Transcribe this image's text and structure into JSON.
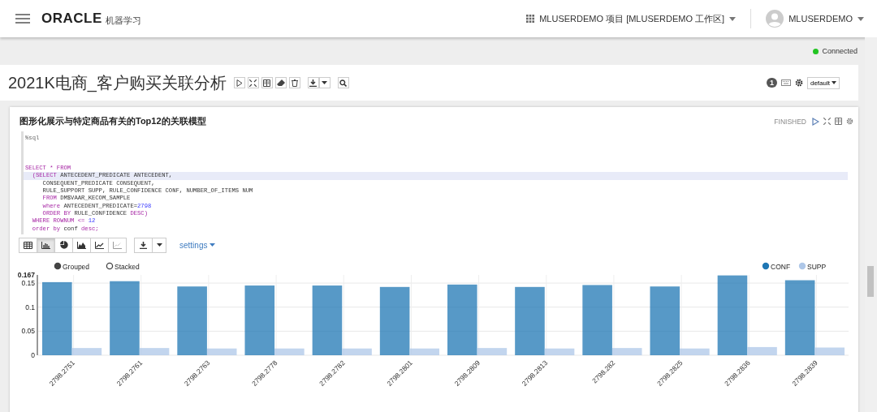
{
  "header": {
    "logo": "ORACLE",
    "product": "机器学习",
    "project": "MLUSERDEMO 项目 [MLUSERDEMO 工作区]",
    "user": "MLUSERDEMO"
  },
  "status": {
    "label": "Connected",
    "connected": true
  },
  "notebook": {
    "title": "2021K电商_客户购买关联分析",
    "badge": "1",
    "view_mode": "default"
  },
  "paragraph": {
    "title": "图形化展示与特定商品有关的Top12的关联模型",
    "state": "FINISHED",
    "code": [
      {
        "kind": "code",
        "highlighted": false,
        "tokens": [
          {
            "kind": "comment",
            "text": "%sql"
          }
        ]
      },
      {
        "kind": "blank"
      },
      {
        "kind": "blank"
      },
      {
        "kind": "blank"
      },
      {
        "kind": "code",
        "highlighted": false,
        "tokens": [
          {
            "kind": "keyword",
            "text": "SELECT * FROM"
          }
        ]
      },
      {
        "kind": "code",
        "highlighted": true,
        "tokens": [
          {
            "kind": "keyword",
            "text": "  (SELECT"
          },
          {
            "kind": "plain",
            "text": " ANTECEDENT_PREDICATE ANTECEDENT,"
          }
        ]
      },
      {
        "kind": "code",
        "highlighted": false,
        "tokens": [
          {
            "kind": "plain",
            "text": "     CONSEQUENT_PREDICATE CONSEQUENT,"
          }
        ]
      },
      {
        "kind": "code",
        "highlighted": false,
        "tokens": [
          {
            "kind": "plain",
            "text": "     RULE_SUPPORT SUPP, RULE_CONFIDENCE CONF, NUMBER_OF_ITEMS NUM"
          }
        ]
      },
      {
        "kind": "code",
        "highlighted": false,
        "tokens": [
          {
            "kind": "keyword",
            "text": "     FROM"
          },
          {
            "kind": "plain",
            "text": " DM$VAAR_KECOM_SAMPLE"
          }
        ]
      },
      {
        "kind": "code",
        "highlighted": false,
        "tokens": [
          {
            "kind": "keyword",
            "text": "     where"
          },
          {
            "kind": "plain",
            "text": " ANTECEDENT_PREDICATE="
          },
          {
            "kind": "number",
            "text": "2798"
          }
        ]
      },
      {
        "kind": "code",
        "highlighted": false,
        "tokens": [
          {
            "kind": "keyword",
            "text": "     ORDER BY"
          },
          {
            "kind": "plain",
            "text": " RULE_CONFIDENCE "
          },
          {
            "kind": "keyword",
            "text": "DESC)"
          }
        ]
      },
      {
        "kind": "code",
        "highlighted": false,
        "tokens": [
          {
            "kind": "keyword",
            "text": "  WHERE ROWNUM <= "
          },
          {
            "kind": "number",
            "text": "12"
          }
        ]
      },
      {
        "kind": "code",
        "highlighted": false,
        "tokens": [
          {
            "kind": "keyword",
            "text": "  order by"
          },
          {
            "kind": "plain",
            "text": " conf "
          },
          {
            "kind": "keyword",
            "text": "desc;"
          }
        ]
      }
    ],
    "views": [
      {
        "kind": "table",
        "selected": false
      },
      {
        "kind": "bar",
        "selected": true
      },
      {
        "kind": "pie",
        "selected": false
      },
      {
        "kind": "area",
        "selected": false
      },
      {
        "kind": "line",
        "selected": false
      },
      {
        "kind": "scatter",
        "selected": false
      }
    ],
    "settings_label": "settings",
    "modes": [
      {
        "label": "Grouped",
        "selected": true
      },
      {
        "label": "Stacked",
        "selected": false
      }
    ],
    "chart_data": {
      "type": "bar",
      "stacked": false,
      "categories": [
        "2798.2751",
        "2798.2761",
        "2798.2763",
        "2798.2778",
        "2798.2782",
        "2798.2801",
        "2798.2809",
        "2798.2813",
        "2798.282",
        "2798.2825",
        "2798.2836",
        "2798.2839"
      ],
      "ylim": [
        0,
        0.167
      ],
      "grid": true,
      "legend": true,
      "yticks": [
        0,
        0.05,
        0.1,
        0.15,
        {
          "value": 0.167,
          "label": "0.167"
        }
      ],
      "series": [
        {
          "name": "CONF",
          "color": "#1f77b4",
          "values": [
            0.152,
            0.154,
            0.143,
            0.145,
            0.145,
            0.142,
            0.147,
            0.142,
            0.146,
            0.143,
            0.166,
            0.156
          ]
        },
        {
          "name": "SUPP",
          "color": "#aec7e8",
          "values": [
            0.015,
            0.015,
            0.014,
            0.014,
            0.014,
            0.014,
            0.015,
            0.014,
            0.015,
            0.014,
            0.017,
            0.016
          ]
        }
      ]
    }
  }
}
